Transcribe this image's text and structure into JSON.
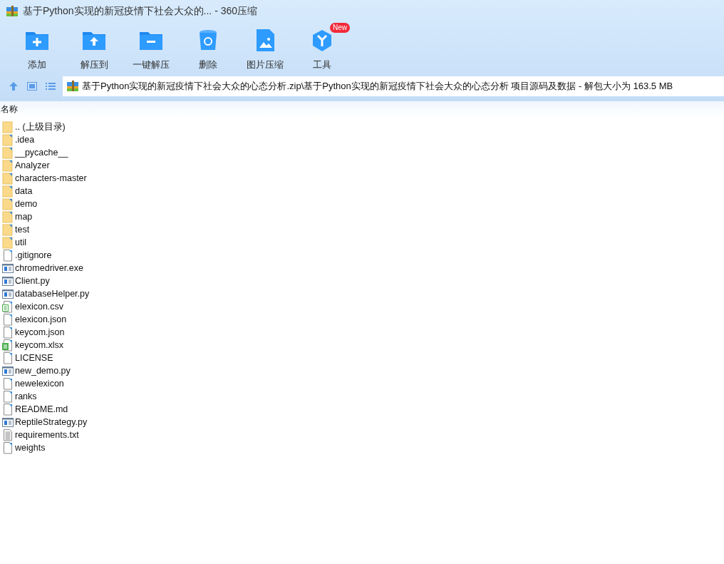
{
  "window": {
    "title": "基于Python实现的新冠疫情下社会大众的... - 360压缩"
  },
  "toolbar": [
    {
      "label": "添加",
      "kind": "add"
    },
    {
      "label": "解压到",
      "kind": "extract"
    },
    {
      "label": "一键解压",
      "kind": "oneclick"
    },
    {
      "label": "删除",
      "kind": "delete"
    },
    {
      "label": "图片压缩",
      "kind": "image"
    },
    {
      "label": "工具",
      "kind": "tools",
      "badge": "New"
    }
  ],
  "address": {
    "path": "基于Python实现的新冠疫情下社会大众的心态分析.zip\\基于Python实现的新冠疫情下社会大众的心态分析 项目源码及数据 - 解包大小为 163.5 MB"
  },
  "table": {
    "columns": [
      "名称"
    ],
    "rows": [
      {
        "name": ".. (上级目录)",
        "kind": "parent"
      },
      {
        "name": ".idea",
        "kind": "folder"
      },
      {
        "name": "__pycache__",
        "kind": "folder"
      },
      {
        "name": "Analyzer",
        "kind": "folder"
      },
      {
        "name": "characters-master",
        "kind": "folder"
      },
      {
        "name": "data",
        "kind": "folder"
      },
      {
        "name": "demo",
        "kind": "folder"
      },
      {
        "name": "map",
        "kind": "folder"
      },
      {
        "name": "test",
        "kind": "folder"
      },
      {
        "name": "util",
        "kind": "folder"
      },
      {
        "name": ".gitignore",
        "kind": "file"
      },
      {
        "name": "chromedriver.exe",
        "kind": "program"
      },
      {
        "name": "Client.py",
        "kind": "program"
      },
      {
        "name": "databaseHelper.py",
        "kind": "program"
      },
      {
        "name": "elexicon.csv",
        "kind": "sheet-outline"
      },
      {
        "name": "elexicon.json",
        "kind": "file"
      },
      {
        "name": "keycom.json",
        "kind": "file"
      },
      {
        "name": "keycom.xlsx",
        "kind": "sheet"
      },
      {
        "name": "LICENSE",
        "kind": "file"
      },
      {
        "name": "new_demo.py",
        "kind": "program"
      },
      {
        "name": "newelexicon",
        "kind": "file"
      },
      {
        "name": "ranks",
        "kind": "file"
      },
      {
        "name": "README.md",
        "kind": "file"
      },
      {
        "name": "ReptileStrategy.py",
        "kind": "program"
      },
      {
        "name": "requirements.txt",
        "kind": "text"
      },
      {
        "name": "weights",
        "kind": "file"
      }
    ]
  }
}
